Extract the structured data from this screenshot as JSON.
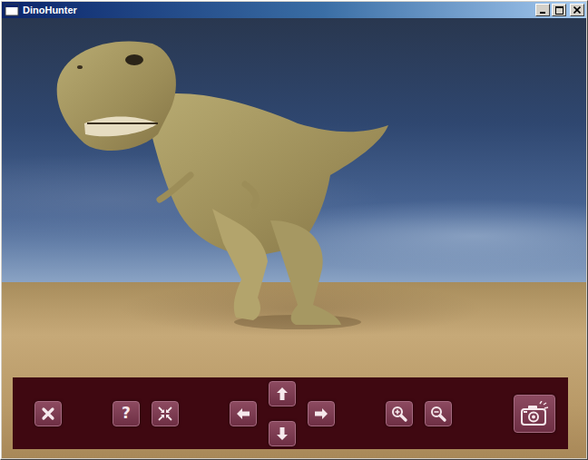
{
  "window": {
    "title": "DinoHunter",
    "controls": [
      {
        "kind": "minimize"
      },
      {
        "kind": "maximize"
      },
      {
        "kind": "close"
      }
    ]
  },
  "toolbar": {
    "groups": [
      {
        "kind": "row",
        "buttons": [
          {
            "kind": "close"
          }
        ]
      },
      {
        "kind": "row",
        "buttons": [
          {
            "kind": "help",
            "label": "?"
          },
          {
            "kind": "fit"
          }
        ]
      },
      {
        "kind": "cross",
        "buttons": [
          {
            "kind": "left"
          },
          {
            "kind": "up"
          },
          {
            "kind": "down"
          },
          {
            "kind": "right"
          }
        ]
      },
      {
        "kind": "row",
        "buttons": [
          {
            "kind": "zoom-in"
          },
          {
            "kind": "zoom-out"
          }
        ]
      },
      {
        "kind": "row",
        "buttons": [
          {
            "kind": "camera"
          }
        ]
      }
    ]
  }
}
